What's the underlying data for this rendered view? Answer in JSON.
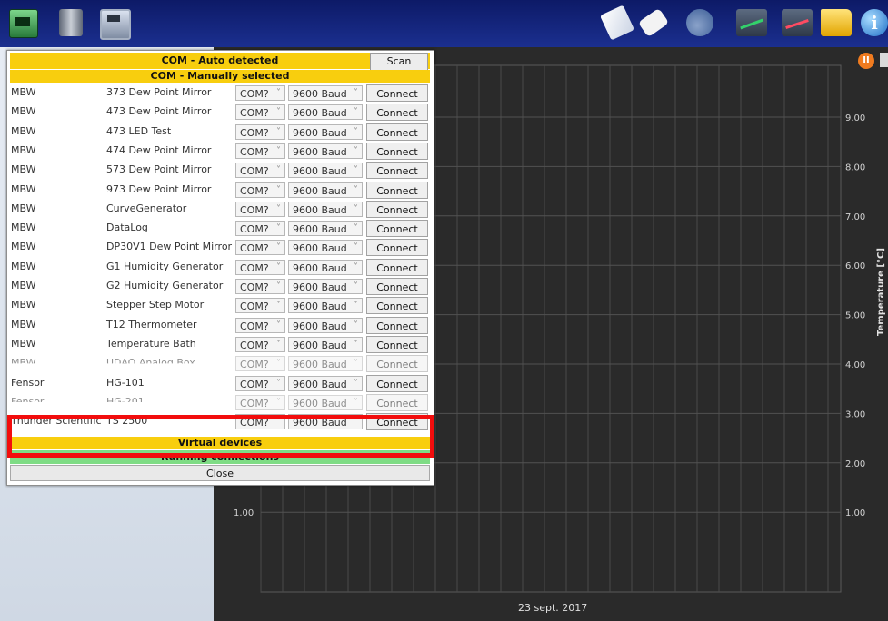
{
  "toolbar": {
    "icons": [
      "board-icon",
      "book-icon",
      "save-icon",
      "calibration-icon",
      "eraser-icon",
      "tools-icon",
      "chart-green-icon",
      "chart-red-icon",
      "folder-icon",
      "info-icon"
    ],
    "info_glyph": "i"
  },
  "dialog": {
    "auto_header": "COM - Auto detected",
    "scan_label": "Scan",
    "manual_header": "COM - Manually selected",
    "rows": [
      {
        "brand": "MBW",
        "device": "373 Dew Point Mirror",
        "com": "COM?",
        "baud": "9600 Baud",
        "button": "Connect"
      },
      {
        "brand": "MBW",
        "device": "473 Dew Point Mirror",
        "com": "COM?",
        "baud": "9600 Baud",
        "button": "Connect"
      },
      {
        "brand": "MBW",
        "device": "473 LED Test",
        "com": "COM?",
        "baud": "9600 Baud",
        "button": "Connect"
      },
      {
        "brand": "MBW",
        "device": "474 Dew Point Mirror",
        "com": "COM?",
        "baud": "9600 Baud",
        "button": "Connect"
      },
      {
        "brand": "MBW",
        "device": "573 Dew Point Mirror",
        "com": "COM?",
        "baud": "9600 Baud",
        "button": "Connect"
      },
      {
        "brand": "MBW",
        "device": "973 Dew Point Mirror",
        "com": "COM?",
        "baud": "9600 Baud",
        "button": "Connect"
      },
      {
        "brand": "MBW",
        "device": "CurveGenerator",
        "com": "COM?",
        "baud": "9600 Baud",
        "button": "Connect"
      },
      {
        "brand": "MBW",
        "device": "DataLog",
        "com": "COM?",
        "baud": "9600 Baud",
        "button": "Connect"
      },
      {
        "brand": "MBW",
        "device": "DP30V1 Dew Point Mirror",
        "com": "COM?",
        "baud": "9600 Baud",
        "button": "Connect"
      },
      {
        "brand": "MBW",
        "device": "G1 Humidity Generator",
        "com": "COM?",
        "baud": "9600 Baud",
        "button": "Connect"
      },
      {
        "brand": "MBW",
        "device": "G2 Humidity Generator",
        "com": "COM?",
        "baud": "9600 Baud",
        "button": "Connect"
      },
      {
        "brand": "MBW",
        "device": "Stepper Step Motor",
        "com": "COM?",
        "baud": "9600 Baud",
        "button": "Connect"
      },
      {
        "brand": "MBW",
        "device": "T12 Thermometer",
        "com": "COM?",
        "baud": "9600 Baud",
        "button": "Connect"
      },
      {
        "brand": "MBW",
        "device": "Temperature Bath",
        "com": "COM?",
        "baud": "9600 Baud",
        "button": "Connect"
      },
      {
        "brand": "MBW",
        "device": "UDAQ Analog Box",
        "com": "COM?",
        "baud": "9600 Baud",
        "button": "Connect"
      },
      {
        "brand": "Fensor",
        "device": "HG-101",
        "com": "COM?",
        "baud": "9600 Baud",
        "button": "Connect"
      },
      {
        "brand": "Fensor",
        "device": "HG-201",
        "com": "COM?",
        "baud": "9600 Baud",
        "button": "Connect"
      },
      {
        "brand": "Thunder Scientific",
        "device": "TS 2500",
        "com": "COM?",
        "baud": "9600 Baud",
        "button": "Connect"
      }
    ],
    "virtual_label": "Virtual devices",
    "running_label": "Running connections",
    "close_label": "Close",
    "highlight_color": "#f20d0d",
    "header_color": "#f8ce0e",
    "running_color": "#7fdc85"
  },
  "chart": {
    "y_ticks": [
      "9.00",
      "8.00",
      "7.00",
      "6.00",
      "5.00",
      "4.00",
      "3.00",
      "2.00",
      "1.00"
    ],
    "left_ticks_visible": [
      "2.00",
      "1.00"
    ],
    "right_axis_label": "Temperature [°C]",
    "x_label": "23 sept. 2017",
    "pause_glyph": "II"
  }
}
